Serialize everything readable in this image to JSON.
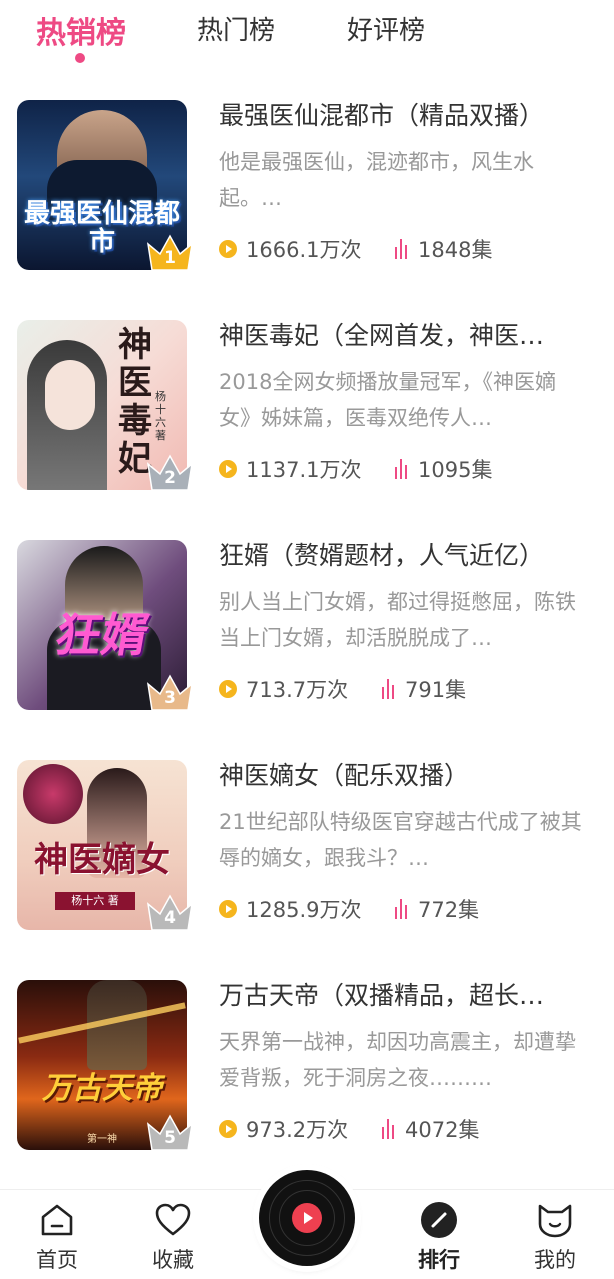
{
  "tabs": [
    {
      "label": "热销榜",
      "active": true
    },
    {
      "label": "热门榜",
      "active": false
    },
    {
      "label": "好评榜",
      "active": false
    }
  ],
  "books": [
    {
      "rank": "1",
      "title": "最强医仙混都市（精品双播）",
      "desc": "他是最强医仙，混迹都市，风生水起。…",
      "plays": "1666.1万次",
      "episodes": "1848集",
      "cover_text": "最强医仙混都市",
      "cover_bg": "#1f3a6e",
      "rank_color": "#f5b51d"
    },
    {
      "rank": "2",
      "title": "神医毒妃（全网首发，神医…",
      "desc": "2018全网女频播放量冠军，《神医嫡女》姊妹篇，医毒双绝传人…",
      "plays": "1137.1万次",
      "episodes": "1095集",
      "cover_text": "神医毒妃",
      "cover_author": "杨十六 著",
      "cover_bg": "#f4d7d2",
      "rank_color": "#a9b0b8"
    },
    {
      "rank": "3",
      "title": "狂婿（赘婿题材，人气近亿）",
      "desc": "别人当上门女婿，都过得挺憋屈，陈铁当上门女婿，却活脱脱成了…",
      "plays": "713.7万次",
      "episodes": "791集",
      "cover_text": "狂婿",
      "cover_bg": "#3b2a4a",
      "rank_color": "#e8b98a"
    },
    {
      "rank": "4",
      "title": "神医嫡女（配乐双播）",
      "desc": "21世纪部队特级医官穿越古代成了被其辱的嫡女，跟我斗？…",
      "plays": "1285.9万次",
      "episodes": "772集",
      "cover_text": "神医嫡女",
      "cover_author": "杨十六 著",
      "cover_bg": "#f3d8c8",
      "rank_color": "#b9b9b9"
    },
    {
      "rank": "5",
      "title": "万古天帝（双播精品，超长…",
      "desc": "天界第一战神，却因功高震主，却遭挚爱背叛，死于洞房之夜………",
      "plays": "973.2万次",
      "episodes": "4072集",
      "cover_text": "万古天帝",
      "cover_author": "第一神",
      "cover_bg": "#3a1a12",
      "rank_color": "#b9b9b9"
    }
  ],
  "nav": [
    {
      "label": "首页",
      "icon": "home-icon"
    },
    {
      "label": "收藏",
      "icon": "heart-icon"
    },
    {
      "label": "排行",
      "icon": "ranking-icon",
      "active": true
    },
    {
      "label": "我的",
      "icon": "profile-icon"
    }
  ],
  "center_player": {
    "icon": "play-disc-icon"
  },
  "colors": {
    "accent": "#ee4a84",
    "play_icon": "#f5b51d",
    "text_muted": "#999999"
  }
}
